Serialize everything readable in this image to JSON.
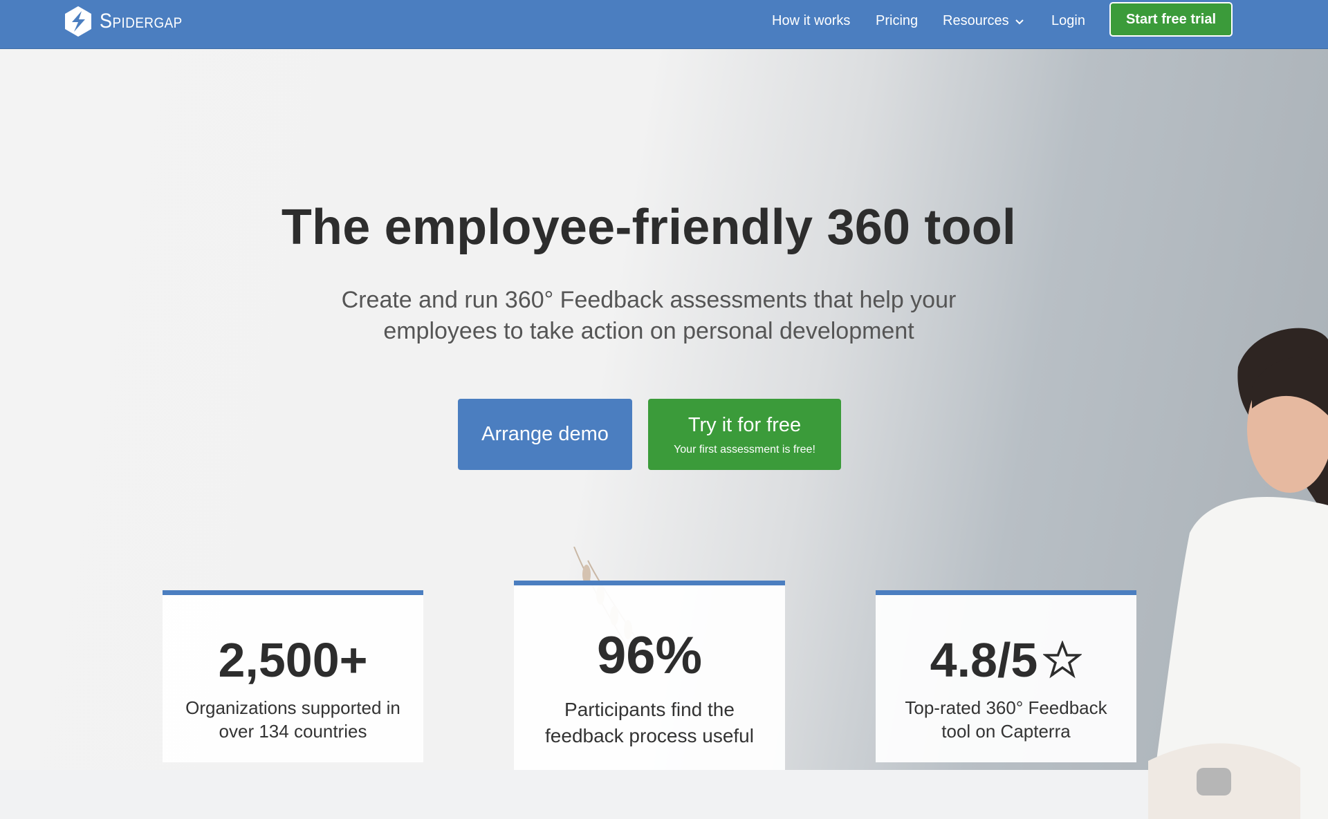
{
  "nav": {
    "brand": "Spidergap",
    "links": [
      "How it works",
      "Pricing",
      "Resources",
      "Login"
    ],
    "cta": "Start free trial"
  },
  "hero": {
    "title": "The employee-friendly 360 tool",
    "subtitle_line1": "Create and run 360° Feedback assessments that help your",
    "subtitle_line2": "employees to take action on personal development",
    "demo_button": "Arrange demo",
    "try_button": "Try it for free",
    "try_button_sub": "Your first assessment is free!"
  },
  "stats": [
    {
      "value": "2,500+",
      "line1": "Organizations supported in",
      "line2": "over 134 countries"
    },
    {
      "value": "96%",
      "line1": "Participants find the",
      "line2": "feedback process useful"
    },
    {
      "value": "4.8/5",
      "line1": "Top-rated 360° Feedback",
      "line2": "tool on Capterra"
    }
  ],
  "colors": {
    "brand_blue": "#4b7ec0",
    "cta_green": "#3b9b3a"
  },
  "icons": [
    "spidergap-logo-icon",
    "chevron-down-icon",
    "star-outline-icon"
  ]
}
